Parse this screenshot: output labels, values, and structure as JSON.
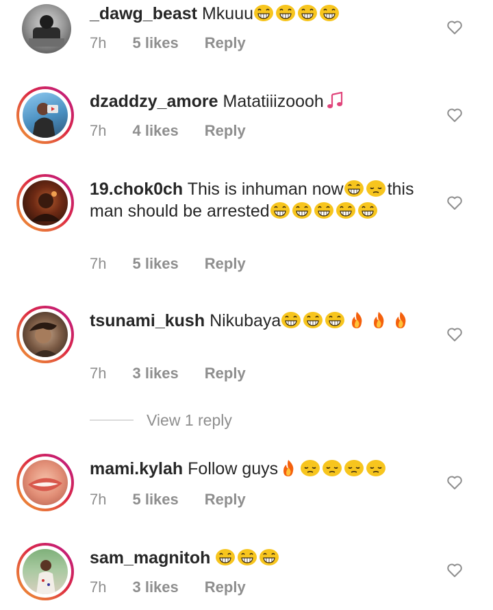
{
  "comments": [
    {
      "username": "_dawg_beast",
      "text": "Mkuuu",
      "emojis": [
        "grin",
        "grin",
        "grin",
        "grin"
      ],
      "time": "7h",
      "likes": "5 likes",
      "reply": "Reply",
      "story_ring": false
    },
    {
      "username": "dzaddzy_amore",
      "text": "Matatiiizoooh",
      "emojis": [
        "music"
      ],
      "time": "7h",
      "likes": "4 likes",
      "reply": "Reply",
      "story_ring": true
    },
    {
      "username": "19.chok0ch",
      "text": "This is inhuman now",
      "text2": "this man should be arrested",
      "emojis": [
        "grin",
        "pensive"
      ],
      "emojis2": [
        "grin",
        "grin",
        "grin",
        "grin",
        "grin"
      ],
      "time": "7h",
      "likes": "5 likes",
      "reply": "Reply",
      "story_ring": true
    },
    {
      "username": "tsunami_kush",
      "text": "Nikubaya",
      "emojis": [
        "grin",
        "grin",
        "grin",
        "fire",
        "fire",
        "fire"
      ],
      "time": "7h",
      "likes": "3 likes",
      "reply": "Reply",
      "story_ring": true
    },
    {
      "username": "mami.kylah",
      "text": "Follow guys",
      "emojis": [
        "fire",
        "pensive",
        "pensive",
        "pensive",
        "pensive"
      ],
      "time": "7h",
      "likes": "5 likes",
      "reply": "Reply",
      "story_ring": true
    },
    {
      "username": "sam_magnitoh",
      "text": "",
      "emojis": [
        "grin",
        "grin",
        "grin"
      ],
      "time": "7h",
      "likes": "3 likes",
      "reply": "Reply",
      "story_ring": true
    }
  ],
  "view_replies": "View 1 reply",
  "colors": {
    "username": "#262626",
    "meta": "#8e8e8e",
    "emoji": "#f7c51e",
    "fire": "#f4600c",
    "music": "#e0457b"
  },
  "icons": {
    "like": "heart-outline-icon",
    "grin": "grinning-face-icon",
    "pensive": "pensive-face-icon",
    "fire": "fire-icon",
    "music": "musical-notes-icon"
  }
}
